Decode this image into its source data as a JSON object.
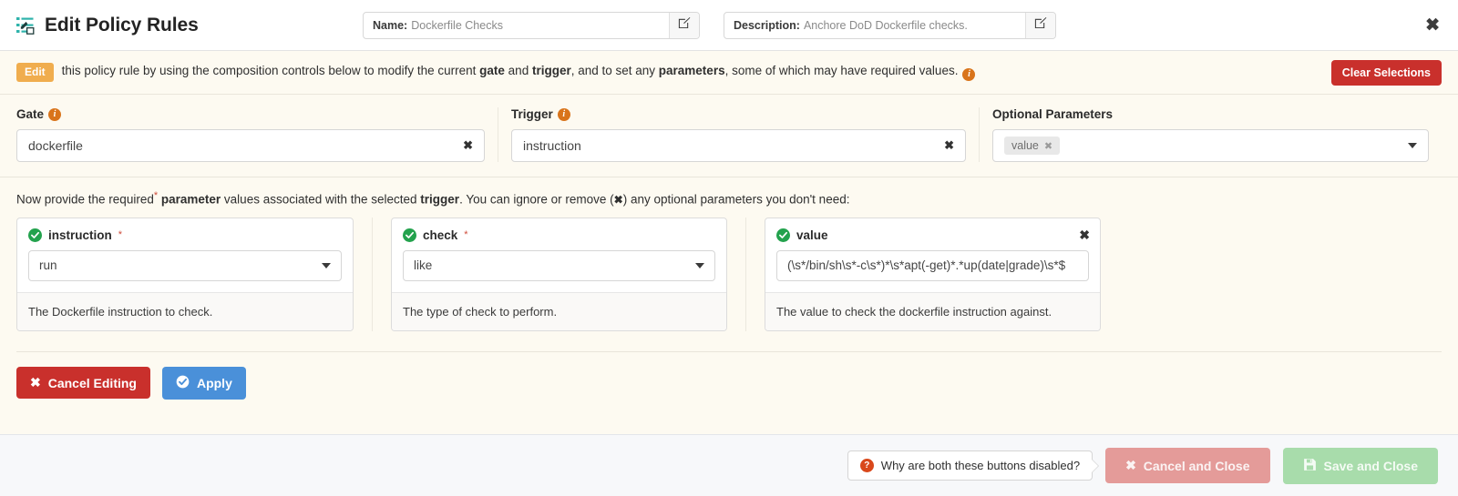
{
  "header": {
    "icon": "list-edit-icon",
    "title": "Edit Policy Rules",
    "name_field": {
      "label": "Name:",
      "value": "Dockerfile Checks",
      "edit_icon": "pencil-square-icon"
    },
    "description_field": {
      "label": "Description:",
      "value": "Anchore DoD Dockerfile checks.",
      "edit_icon": "pencil-square-icon"
    },
    "close_icon": "close-icon"
  },
  "instruction_bar": {
    "badge": "Edit",
    "text_part1": "this policy rule by using the composition controls below to modify the current ",
    "bold1": "gate",
    "text_part2": " and ",
    "bold2": "trigger",
    "text_part3": ", and to set any ",
    "bold3": "parameters",
    "text_part4": ", some of which may have required values.",
    "info_icon": "info-icon",
    "info_glyph": "i",
    "clear_button": "Clear Selections"
  },
  "selectors": {
    "gate": {
      "label": "Gate",
      "info_icon": "info-icon",
      "info_glyph": "i",
      "value": "dockerfile",
      "clear_glyph": "✖"
    },
    "trigger": {
      "label": "Trigger",
      "info_icon": "info-icon",
      "info_glyph": "i",
      "value": "instruction",
      "clear_glyph": "✖"
    },
    "optional_parameters": {
      "label": "Optional Parameters",
      "chips": [
        {
          "label": "value",
          "remove_glyph": "✖"
        }
      ],
      "caret_icon": "chevron-down-icon"
    }
  },
  "param_intro": {
    "part1": "Now provide the required",
    "star": "*",
    "bold1": " parameter",
    "part2": " values associated with the selected ",
    "bold2": "trigger",
    "part3": ". You can ignore or remove (",
    "x_glyph": "✖",
    "part4": ") any optional parameters you don't need:"
  },
  "param_cards": [
    {
      "status_icon": "check-circle-icon",
      "name": "instruction",
      "required_star": "*",
      "control_type": "select",
      "value": "run",
      "caret_icon": "chevron-down-icon",
      "removable": false,
      "description": "The Dockerfile instruction to check."
    },
    {
      "status_icon": "check-circle-icon",
      "name": "check",
      "required_star": "*",
      "control_type": "select",
      "value": "like",
      "caret_icon": "chevron-down-icon",
      "removable": false,
      "description": "The type of check to perform."
    },
    {
      "status_icon": "check-circle-icon",
      "name": "value",
      "required_star": "",
      "control_type": "text",
      "value": "(\\s*/bin/sh\\s*-c\\s*)*\\s*apt(-get)*.*up(date|grade)\\s*$",
      "remove_glyph": "✖",
      "removable": true,
      "description": "The value to check the dockerfile instruction against."
    }
  ],
  "actions": {
    "cancel_editing": {
      "label": "Cancel Editing",
      "icon": "close-icon",
      "glyph": "✖"
    },
    "apply": {
      "label": "Apply",
      "icon": "check-circle-icon"
    }
  },
  "footer": {
    "tooltip": {
      "icon": "question-icon",
      "glyph": "?",
      "label": "Why are both these buttons disabled?"
    },
    "cancel_and_close": {
      "label": "Cancel and Close",
      "icon": "close-icon",
      "glyph": "✖",
      "disabled": true
    },
    "save_and_close": {
      "label": "Save and Close",
      "icon": "save-disk-icon",
      "disabled": true
    }
  },
  "colors": {
    "page_background": "#fdfaf1",
    "header_background": "#ffffff",
    "footer_background": "#f7f8fa",
    "accent_teal": "#2fb3ab",
    "danger_red": "#c9302c",
    "primary_blue": "#4a90d9",
    "warning_yellow": "#f0ad4e",
    "info_orange": "#d9741b",
    "success_green": "#23a24d",
    "disabled_red": "#e49b99",
    "disabled_green": "#a8dcab"
  }
}
